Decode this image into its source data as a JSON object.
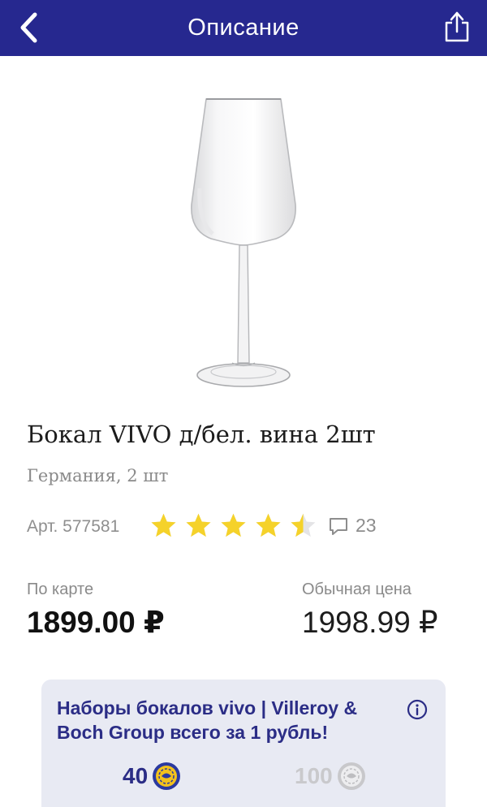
{
  "header": {
    "title": "Описание"
  },
  "product": {
    "name": "Бокал VIVO д/бел. вина 2шт",
    "subtitle": "Германия, 2 шт",
    "article": "Арт. 577581",
    "rating": 4.5,
    "rating_max": 5,
    "reviews_count": "23"
  },
  "prices": {
    "card_label": "По карте",
    "card_price": "1899.00 ₽",
    "regular_label": "Обычная цена",
    "regular_price": "1998.99 ₽"
  },
  "promo": {
    "text": "Наборы бокалов vivo | Villeroy & Boch Group всего за 1 рубль!",
    "points_active": "40",
    "points_inactive": "100"
  },
  "colors": {
    "brand": "#26288f",
    "star": "#f5d22a",
    "promo_text": "#2b2d86",
    "promo_bg": "#e8eaf3"
  },
  "icons": {
    "back": "chevron-left-icon",
    "share": "share-icon",
    "reviews": "comment-icon",
    "info": "info-icon",
    "coin_active": "coin-icon",
    "coin_inactive": "coin-icon"
  }
}
